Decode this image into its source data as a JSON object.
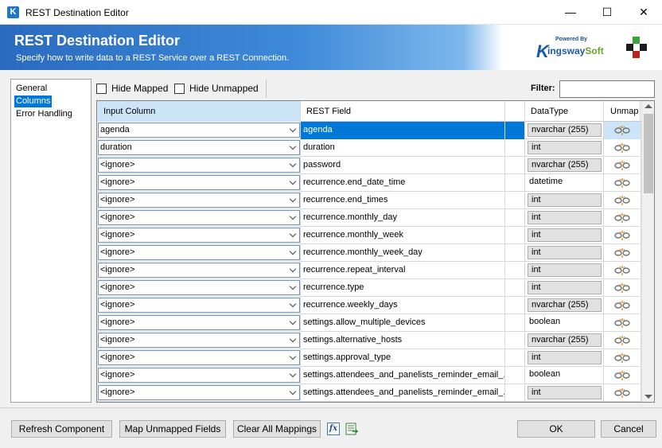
{
  "window": {
    "title": "REST Destination Editor"
  },
  "banner": {
    "title": "REST Destination Editor",
    "subtitle": "Specify how to write data to a REST Service over a REST Connection.",
    "logo_powered": "Powered By",
    "logo_k": "K",
    "logo_name": "ingsway",
    "logo_soft": "Soft"
  },
  "nav": {
    "items": [
      "General",
      "Columns",
      "Error Handling"
    ],
    "selected": 1
  },
  "toolbar": {
    "hide_mapped": "Hide Mapped",
    "hide_unmapped": "Hide Unmapped",
    "filter_label": "Filter:",
    "filter_value": ""
  },
  "grid": {
    "headers": {
      "input": "Input Column",
      "rest": "REST Field",
      "dtype": "DataType",
      "unmap": "Unmap"
    },
    "rows": [
      {
        "input": "agenda",
        "rest": "agenda",
        "dtype": "nvarchar (255)",
        "readonly": true
      },
      {
        "input": "duration",
        "rest": "duration",
        "dtype": "int",
        "readonly": true
      },
      {
        "input": "<ignore>",
        "rest": "password",
        "dtype": "nvarchar (255)",
        "readonly": true
      },
      {
        "input": "<ignore>",
        "rest": "recurrence.end_date_time",
        "dtype": "datetime",
        "readonly": false
      },
      {
        "input": "<ignore>",
        "rest": "recurrence.end_times",
        "dtype": "int",
        "readonly": true
      },
      {
        "input": "<ignore>",
        "rest": "recurrence.monthly_day",
        "dtype": "int",
        "readonly": true
      },
      {
        "input": "<ignore>",
        "rest": "recurrence.monthly_week",
        "dtype": "int",
        "readonly": true
      },
      {
        "input": "<ignore>",
        "rest": "recurrence.monthly_week_day",
        "dtype": "int",
        "readonly": true
      },
      {
        "input": "<ignore>",
        "rest": "recurrence.repeat_interval",
        "dtype": "int",
        "readonly": true
      },
      {
        "input": "<ignore>",
        "rest": "recurrence.type",
        "dtype": "int",
        "readonly": true
      },
      {
        "input": "<ignore>",
        "rest": "recurrence.weekly_days",
        "dtype": "nvarchar (255)",
        "readonly": true
      },
      {
        "input": "<ignore>",
        "rest": "settings.allow_multiple_devices",
        "dtype": "boolean",
        "readonly": false
      },
      {
        "input": "<ignore>",
        "rest": "settings.alternative_hosts",
        "dtype": "nvarchar (255)",
        "readonly": true
      },
      {
        "input": "<ignore>",
        "rest": "settings.approval_type",
        "dtype": "int",
        "readonly": true
      },
      {
        "input": "<ignore>",
        "rest": "settings.attendees_and_panelists_reminder_email_...",
        "dtype": "boolean",
        "readonly": false
      },
      {
        "input": "<ignore>",
        "rest": "settings.attendees_and_panelists_reminder_email_...",
        "dtype": "int",
        "readonly": true
      }
    ],
    "selected_row": 0
  },
  "buttons": {
    "refresh": "Refresh Component",
    "map_unmapped": "Map Unmapped Fields",
    "clear_all": "Clear All Mappings",
    "fx": "fx",
    "ok": "OK",
    "cancel": "Cancel"
  },
  "colors": {
    "accent": "#0078d7",
    "banner_start": "#2a6bbf",
    "banner_mid": "#3e8ad8",
    "logo_blue": "#1a5aa8",
    "logo_green": "#6aa52c"
  }
}
